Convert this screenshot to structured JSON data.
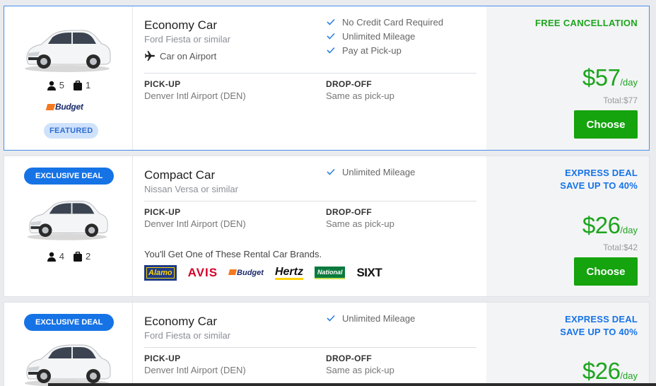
{
  "colors": {
    "accent_blue": "#1673e6",
    "price_green": "#1da51d",
    "button_green": "#15a30e"
  },
  "listings": [
    {
      "title": "Economy Car",
      "subtitle": "Ford Fiesta or similar",
      "airport_note": "Car on Airport",
      "passengers": "5",
      "bags": "1",
      "vendor": "Budget",
      "featured_label": "FEATURED",
      "features": [
        "No Credit Card Required",
        "Unlimited Mileage",
        "Pay at Pick-up"
      ],
      "pickup_label": "PICK-UP",
      "pickup_value": "Denver Intl Airport (DEN)",
      "dropoff_label": "DROP-OFF",
      "dropoff_value": "Same as pick-up",
      "deal_label": "FREE CANCELLATION",
      "price": "$57",
      "per": "/day",
      "total": "Total:$77",
      "cta": "Choose"
    },
    {
      "badge": "EXCLUSIVE DEAL",
      "title": "Compact Car",
      "subtitle": "Nissan Versa or similar",
      "passengers": "4",
      "bags": "2",
      "features": [
        "Unlimited Mileage"
      ],
      "pickup_label": "PICK-UP",
      "pickup_value": "Denver Intl Airport (DEN)",
      "dropoff_label": "DROP-OFF",
      "dropoff_value": "Same as pick-up",
      "brands_title": "You'll Get One of These Rental Car Brands.",
      "brands": [
        "Alamo",
        "AVIS",
        "Budget",
        "Hertz",
        "National",
        "SIXT"
      ],
      "deal_line1": "EXPRESS DEAL",
      "deal_line2": "SAVE UP TO 40%",
      "price": "$26",
      "per": "/day",
      "total": "Total:$42",
      "cta": "Choose"
    },
    {
      "badge": "EXCLUSIVE DEAL",
      "title": "Economy Car",
      "subtitle": "Ford Fiesta or similar",
      "features": [
        "Unlimited Mileage"
      ],
      "pickup_label": "PICK-UP",
      "pickup_value": "Denver Intl Airport (DEN)",
      "dropoff_label": "DROP-OFF",
      "dropoff_value": "Same as pick-up",
      "deal_line1": "EXPRESS DEAL",
      "deal_line2": "SAVE UP TO 40%",
      "price": "$26",
      "per": "/day"
    }
  ],
  "icons": {
    "person": "person-icon",
    "bag": "luggage-icon",
    "plane": "plane-icon",
    "check": "check-icon"
  }
}
